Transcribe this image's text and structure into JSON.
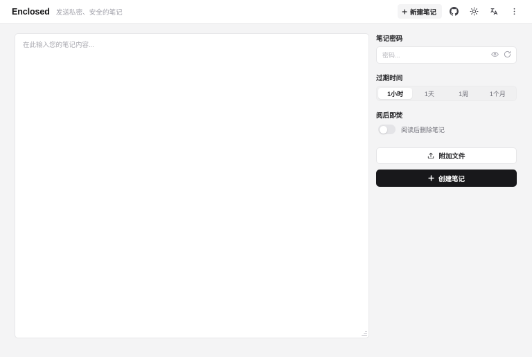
{
  "header": {
    "brand_name": "Enclosed",
    "tagline": "发送私密、安全的笔记",
    "new_note_label": "新建笔记",
    "new_note_icon": "plus-icon",
    "github_icon": "github-icon",
    "theme_icon": "sun-icon",
    "language_icon": "translate-icon",
    "menu_icon": "more-vertical-icon"
  },
  "editor": {
    "placeholder": "在此输入您的笔记内容...",
    "value": ""
  },
  "panel": {
    "password": {
      "label": "笔记密码",
      "placeholder": "密码...",
      "value": "",
      "reveal_icon": "eye-icon",
      "generate_icon": "refresh-icon"
    },
    "expiration": {
      "label": "过期时间",
      "options": [
        "1小时",
        "1天",
        "1周",
        "1个月"
      ],
      "selected_index": 0
    },
    "burn": {
      "label": "阅后即焚",
      "caption": "阅读后删除笔记",
      "enabled": false
    },
    "attach": {
      "label": "附加文件",
      "icon": "upload-icon"
    },
    "create": {
      "label": "创建笔记",
      "icon": "plus-icon"
    }
  },
  "colors": {
    "page_background": "#f4f4f5",
    "surface": "#ffffff",
    "border": "#e7e7e9",
    "text_primary": "#18181b",
    "text_muted": "#a1a1aa",
    "accent": "#18181b"
  }
}
